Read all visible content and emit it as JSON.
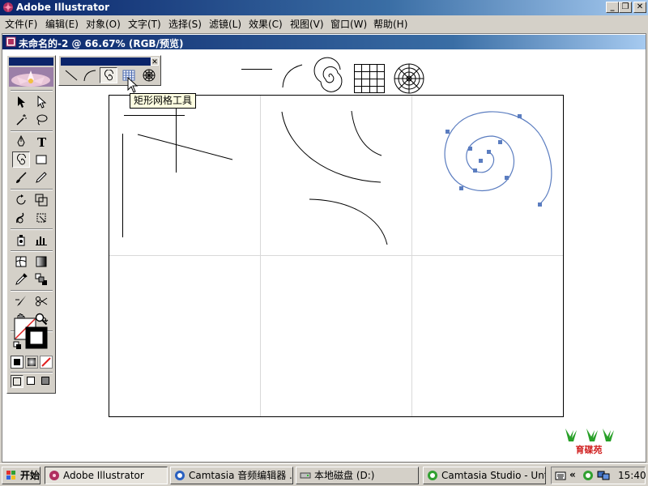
{
  "app": {
    "title": "Adobe Illustrator"
  },
  "menu": [
    "文件(F)",
    "编辑(E)",
    "对象(O)",
    "文字(T)",
    "选择(S)",
    "滤镜(L)",
    "效果(C)",
    "视图(V)",
    "窗口(W)",
    "帮助(H)"
  ],
  "window_controls": {
    "minimize": "_",
    "restore": "❐",
    "close": "✕"
  },
  "document": {
    "title": "未命名的-2 @ 66.67% (RGB/预览)"
  },
  "toolbox": {
    "type_tool_glyph": "T",
    "tools": [
      "selection",
      "direct-selection",
      "magic-wand",
      "lasso",
      "pen",
      "type",
      "spiral",
      "rectangle",
      "paintbrush",
      "pencil",
      "rotate",
      "scale",
      "warp",
      "free-transform",
      "symbol-sprayer",
      "graph",
      "mesh",
      "gradient",
      "eyedropper",
      "blend",
      "slice",
      "scissors",
      "hand",
      "zoom"
    ]
  },
  "flyout": {
    "tools": [
      "line-segment",
      "arc",
      "spiral",
      "rectangular-grid",
      "polar-grid"
    ],
    "close_glyph": "✕"
  },
  "tooltip": "矩形网格工具",
  "accent": {
    "titlebar": "#0a246a",
    "path": "#5b7dc0"
  },
  "taskbar": {
    "start": "开始",
    "buttons": [
      "Adobe Illustrator",
      "Camtasia 音频编辑器 ...",
      "本地磁盘 (D:)",
      "Camtasia Studio - Untitl..."
    ],
    "tray_chevron": "«",
    "clock": "15:40"
  },
  "logo": {
    "text": "育碟苑"
  }
}
